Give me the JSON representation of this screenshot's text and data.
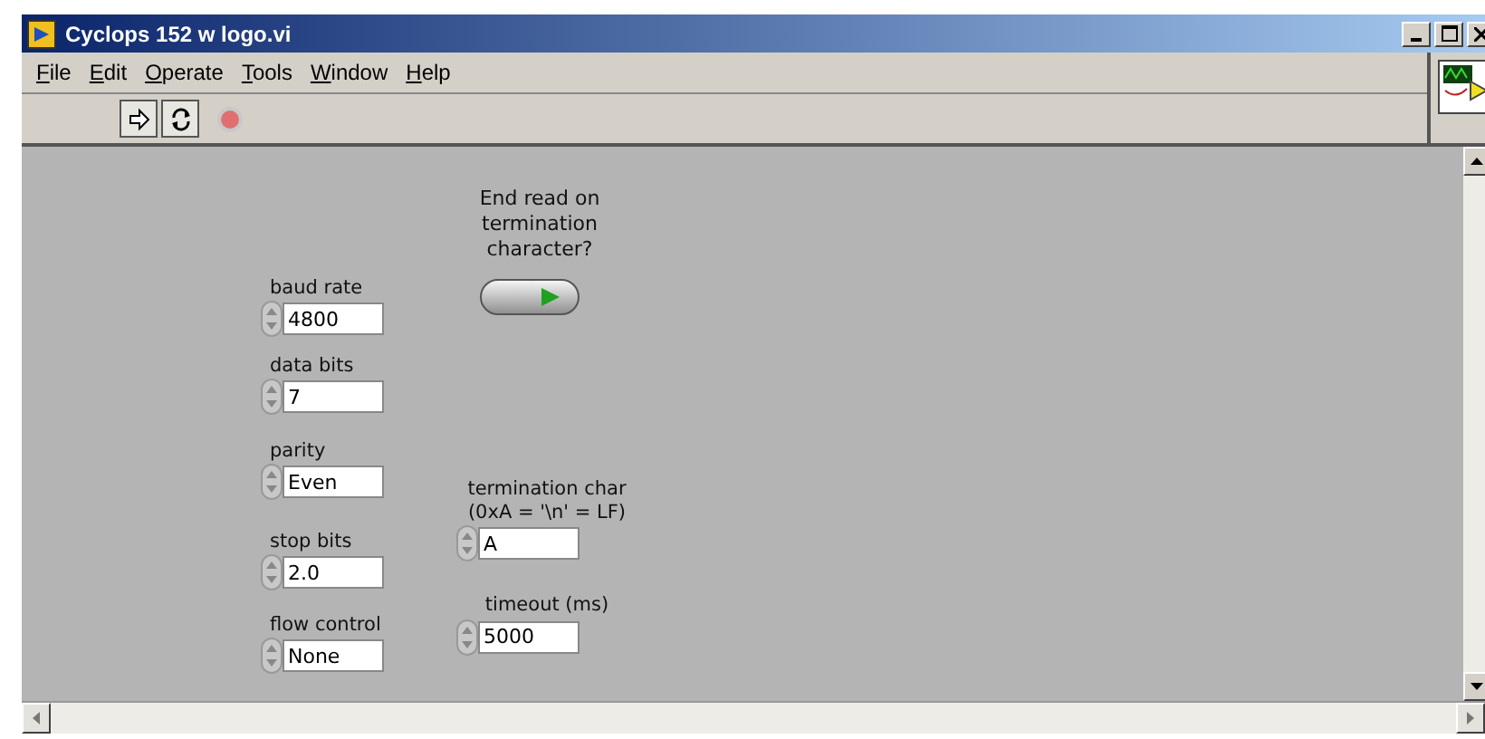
{
  "window": {
    "title": "Cyclops 152 w logo.vi"
  },
  "menu": [
    {
      "label": "File"
    },
    {
      "label": "Edit"
    },
    {
      "label": "Operate"
    },
    {
      "label": "Tools"
    },
    {
      "label": "Window"
    },
    {
      "label": "Help"
    }
  ],
  "left_controls": [
    {
      "label": "baud rate",
      "value": "4800"
    },
    {
      "label": "data bits",
      "value": "7"
    },
    {
      "label": "parity",
      "value": "Even"
    },
    {
      "label": "stop bits",
      "value": "2.0"
    },
    {
      "label": "flow control",
      "value": "None"
    }
  ],
  "end_read": {
    "label": "End read on termination character?",
    "on": true
  },
  "right_controls": [
    {
      "label": "termination char (0xA = '\\n' = LF)",
      "value": "A"
    },
    {
      "label": "timeout (ms)",
      "value": "5000"
    }
  ]
}
